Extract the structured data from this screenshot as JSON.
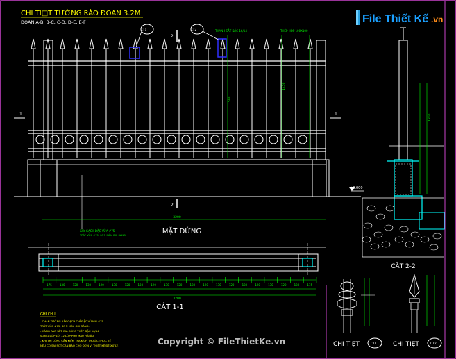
{
  "title": "CHI TI□T TƯỜNG RÀO ĐOAN 3.2M",
  "subtitle": "ĐOAN A-B, B-C, C-D, D-E, E-F",
  "logo": {
    "text": "File Thiết Kế",
    "suffix": ".vn"
  },
  "views": {
    "elevation": "MẶT ĐỨNG",
    "section_1_1": "CẮT 1-1",
    "section_2_2": "CẮT 2-2",
    "detail_1": "CHI TIẸT",
    "detail_2": "CHI TIẸT"
  },
  "tags": {
    "ct1": "CT1",
    "ct2": "CT2"
  },
  "section_marks": {
    "one": "1",
    "two": "2"
  },
  "notes": {
    "heading": "GHI CHÚ",
    "lines": [
      "- CHÂN TƯỜNG XÂY GẠCH CHỈ ĐẶC VỪA M #75.",
      "  TRÁT VỪA #75, SƠN MÀU GHI SÁNG.",
      "- HÀNG RÀO SẮT GIA CÔNG THÉP ĐẶC 16/14",
      "  SƠN 1 LỚP LÓT, 2 LỚP PHỦ MÀU HẢI ÂU.",
      "- KHI THI CÔNG CẦN KIỂM TRA KÍCH THƯỚC THỰC TẾ",
      "  NẾU CÓ SAI SÓT CẦN BÁO CHO ĐƠN VỊ THIẾT KẾ ĐỂ XỬ LÝ."
    ]
  },
  "dims": {
    "bay": "3200",
    "post_gap": "3200",
    "spacing": [
      "175",
      "130",
      "120",
      "130",
      "120",
      "130",
      "120",
      "130",
      "120",
      "130",
      "120",
      "130",
      "120",
      "130",
      "120",
      "130",
      "120",
      "130",
      "120",
      "130",
      "175"
    ],
    "heights": [
      "1500",
      "1450",
      "1800"
    ]
  },
  "annotations": {
    "steel_bar": "THANH SẮT ĐẶC 16/14",
    "steel_top": "THÉP HỘP 100X100",
    "wall_note": "XÂY GẠCH ĐẶC VỪA #75",
    "wall_note2": "TRÁT VỪA #75, SƠN MÀU GHI SÁNG",
    "level": "±0.000"
  },
  "copyright": "Copyright © FileThietKe.vn",
  "colors": {
    "frame": "#cc44cc",
    "title": "#ffff00",
    "cyan": "#00ffff",
    "white": "#ffffff",
    "green": "#00ff00",
    "blue": "#3030ff"
  }
}
